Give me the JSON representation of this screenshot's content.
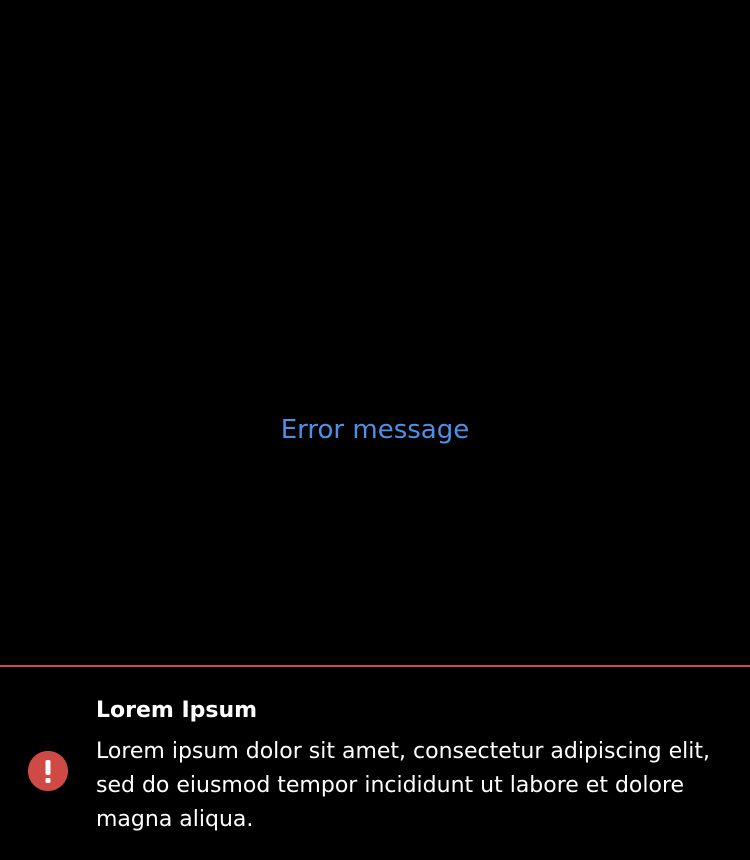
{
  "main": {
    "link_text": "Error message",
    "link_color": "#4f8fe6"
  },
  "toast": {
    "title": "Lorem Ipsum",
    "message": "Lorem ipsum dolor sit amet, consectetur adipiscing elit, sed do eiusmod tempor incididunt ut labore et dolore magna aliqua.",
    "icon": "error-icon",
    "accent_color": "#cf4a45"
  }
}
